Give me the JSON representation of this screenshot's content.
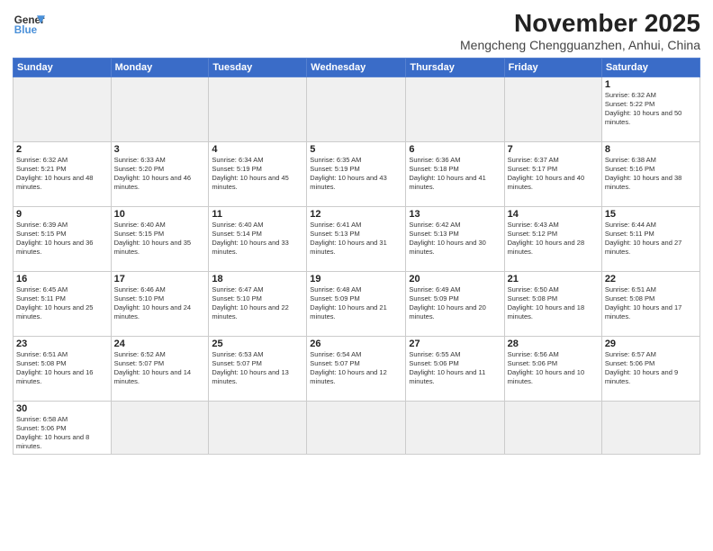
{
  "logo": {
    "line1": "General",
    "line2": "Blue"
  },
  "title": "November 2025",
  "location": "Mengcheng Chengguanzhen, Anhui, China",
  "weekdays": [
    "Sunday",
    "Monday",
    "Tuesday",
    "Wednesday",
    "Thursday",
    "Friday",
    "Saturday"
  ],
  "weeks": [
    [
      {
        "day": null
      },
      {
        "day": null
      },
      {
        "day": null
      },
      {
        "day": null
      },
      {
        "day": null
      },
      {
        "day": null
      },
      {
        "day": 1,
        "sunrise": "6:32 AM",
        "sunset": "5:22 PM",
        "daylight": "10 hours and 50 minutes."
      }
    ],
    [
      {
        "day": 2,
        "sunrise": "6:32 AM",
        "sunset": "5:21 PM",
        "daylight": "10 hours and 48 minutes."
      },
      {
        "day": 3,
        "sunrise": "6:33 AM",
        "sunset": "5:20 PM",
        "daylight": "10 hours and 46 minutes."
      },
      {
        "day": 4,
        "sunrise": "6:34 AM",
        "sunset": "5:19 PM",
        "daylight": "10 hours and 45 minutes."
      },
      {
        "day": 5,
        "sunrise": "6:35 AM",
        "sunset": "5:19 PM",
        "daylight": "10 hours and 43 minutes."
      },
      {
        "day": 6,
        "sunrise": "6:36 AM",
        "sunset": "5:18 PM",
        "daylight": "10 hours and 41 minutes."
      },
      {
        "day": 7,
        "sunrise": "6:37 AM",
        "sunset": "5:17 PM",
        "daylight": "10 hours and 40 minutes."
      },
      {
        "day": 8,
        "sunrise": "6:38 AM",
        "sunset": "5:16 PM",
        "daylight": "10 hours and 38 minutes."
      }
    ],
    [
      {
        "day": 9,
        "sunrise": "6:39 AM",
        "sunset": "5:15 PM",
        "daylight": "10 hours and 36 minutes."
      },
      {
        "day": 10,
        "sunrise": "6:40 AM",
        "sunset": "5:15 PM",
        "daylight": "10 hours and 35 minutes."
      },
      {
        "day": 11,
        "sunrise": "6:40 AM",
        "sunset": "5:14 PM",
        "daylight": "10 hours and 33 minutes."
      },
      {
        "day": 12,
        "sunrise": "6:41 AM",
        "sunset": "5:13 PM",
        "daylight": "10 hours and 31 minutes."
      },
      {
        "day": 13,
        "sunrise": "6:42 AM",
        "sunset": "5:13 PM",
        "daylight": "10 hours and 30 minutes."
      },
      {
        "day": 14,
        "sunrise": "6:43 AM",
        "sunset": "5:12 PM",
        "daylight": "10 hours and 28 minutes."
      },
      {
        "day": 15,
        "sunrise": "6:44 AM",
        "sunset": "5:11 PM",
        "daylight": "10 hours and 27 minutes."
      }
    ],
    [
      {
        "day": 16,
        "sunrise": "6:45 AM",
        "sunset": "5:11 PM",
        "daylight": "10 hours and 25 minutes."
      },
      {
        "day": 17,
        "sunrise": "6:46 AM",
        "sunset": "5:10 PM",
        "daylight": "10 hours and 24 minutes."
      },
      {
        "day": 18,
        "sunrise": "6:47 AM",
        "sunset": "5:10 PM",
        "daylight": "10 hours and 22 minutes."
      },
      {
        "day": 19,
        "sunrise": "6:48 AM",
        "sunset": "5:09 PM",
        "daylight": "10 hours and 21 minutes."
      },
      {
        "day": 20,
        "sunrise": "6:49 AM",
        "sunset": "5:09 PM",
        "daylight": "10 hours and 20 minutes."
      },
      {
        "day": 21,
        "sunrise": "6:50 AM",
        "sunset": "5:08 PM",
        "daylight": "10 hours and 18 minutes."
      },
      {
        "day": 22,
        "sunrise": "6:51 AM",
        "sunset": "5:08 PM",
        "daylight": "10 hours and 17 minutes."
      }
    ],
    [
      {
        "day": 23,
        "sunrise": "6:51 AM",
        "sunset": "5:08 PM",
        "daylight": "10 hours and 16 minutes."
      },
      {
        "day": 24,
        "sunrise": "6:52 AM",
        "sunset": "5:07 PM",
        "daylight": "10 hours and 14 minutes."
      },
      {
        "day": 25,
        "sunrise": "6:53 AM",
        "sunset": "5:07 PM",
        "daylight": "10 hours and 13 minutes."
      },
      {
        "day": 26,
        "sunrise": "6:54 AM",
        "sunset": "5:07 PM",
        "daylight": "10 hours and 12 minutes."
      },
      {
        "day": 27,
        "sunrise": "6:55 AM",
        "sunset": "5:06 PM",
        "daylight": "10 hours and 11 minutes."
      },
      {
        "day": 28,
        "sunrise": "6:56 AM",
        "sunset": "5:06 PM",
        "daylight": "10 hours and 10 minutes."
      },
      {
        "day": 29,
        "sunrise": "6:57 AM",
        "sunset": "5:06 PM",
        "daylight": "10 hours and 9 minutes."
      }
    ],
    [
      {
        "day": 30,
        "sunrise": "6:58 AM",
        "sunset": "5:06 PM",
        "daylight": "10 hours and 8 minutes."
      },
      {
        "day": null
      },
      {
        "day": null
      },
      {
        "day": null
      },
      {
        "day": null
      },
      {
        "day": null
      },
      {
        "day": null
      }
    ]
  ]
}
